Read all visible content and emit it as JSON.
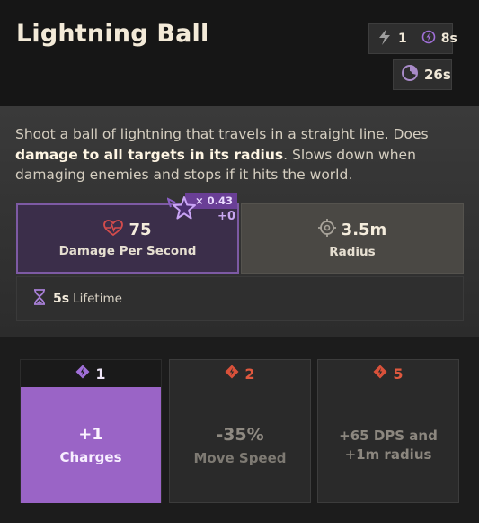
{
  "ability": {
    "title": "Lightning Ball",
    "charges": "1",
    "charge_cooldown": "8s",
    "cooldown": "26s"
  },
  "description": {
    "part1": "Shoot a ball of lightning that travels in a straight line. Does ",
    "bold": "damage to all targets in its radius",
    "part2": ". Slows down when damaging enemies and stops if it hits the world."
  },
  "stats": {
    "dps": {
      "value": "75",
      "label": "Damage Per Second",
      "scale_multiplier": "× 0.43",
      "scale_bonus": "+0"
    },
    "radius": {
      "value": "3.5m",
      "label": "Radius"
    },
    "lifetime": {
      "value": "5s",
      "label": "Lifetime"
    }
  },
  "upgrades": [
    {
      "cost": "1",
      "line1": "+1",
      "line2": "Charges",
      "active": true
    },
    {
      "cost": "2",
      "line1": "-35%",
      "line2": "Move Speed",
      "active": false
    },
    {
      "cost": "5",
      "line1": "+65 DPS and +1m radius",
      "active": false
    }
  ],
  "colors": {
    "accent_purple": "#9a64c6",
    "spirit_purple": "#7d5aa4",
    "cost_red": "#e0593f"
  },
  "icons": {
    "charges": "lightning-bolt-icon",
    "charge_cooldown": "spirit-bolt-icon",
    "cooldown": "cooldown-clock-icon",
    "dps": "heart-pulse-icon",
    "radius": "crosshair-icon",
    "lifetime": "hourglass-icon",
    "scaling": "spirit-star-icon",
    "cost_active": "purple-diamond-icon",
    "cost_locked": "red-diamond-icon"
  }
}
